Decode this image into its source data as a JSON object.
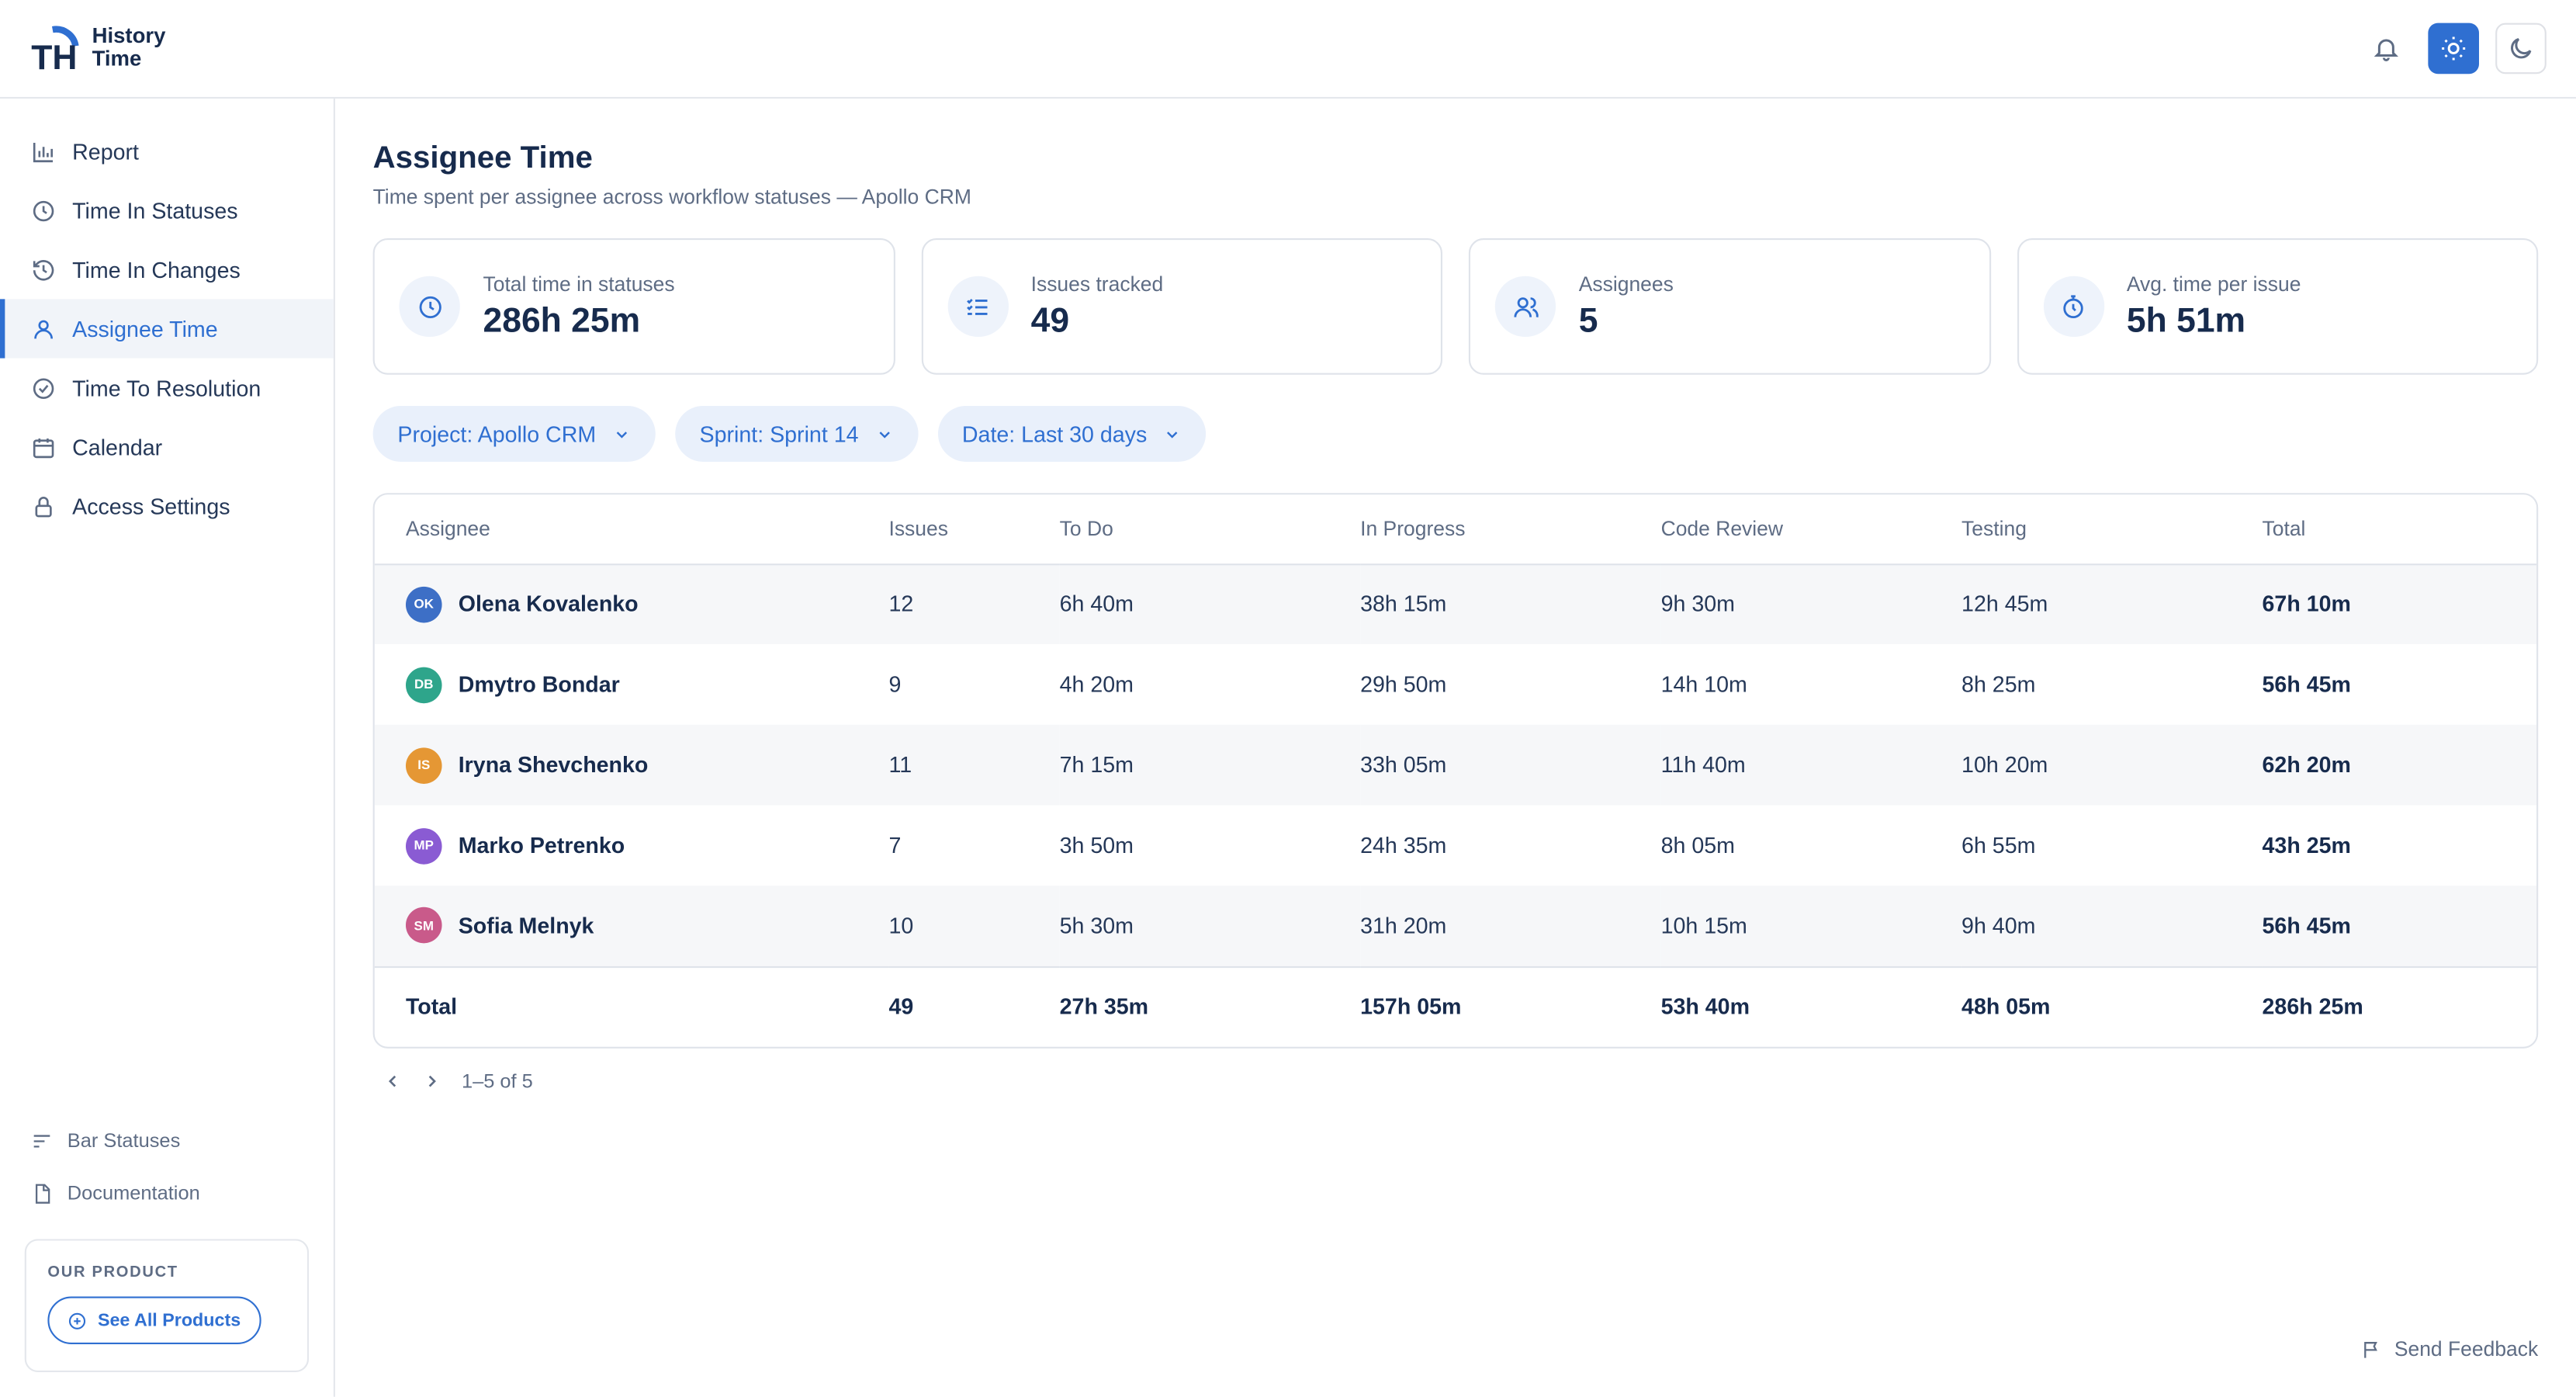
{
  "app": {
    "name_line1": "History",
    "name_line2": "Time",
    "logo_text": "TH"
  },
  "colors": {
    "accent": "#2f6fd1",
    "avatar_ok": "#3d6fc6",
    "avatar_db": "#2ea58b",
    "avatar_is": "#e59734",
    "avatar_mp": "#8a5bd3",
    "avatar_sm": "#c95a8a"
  },
  "header": {
    "icons": [
      "bell-icon",
      "sun-icon",
      "moon-icon"
    ]
  },
  "sidebar": {
    "items": [
      {
        "label": "Report",
        "icon": "bar-chart-icon"
      },
      {
        "label": "Time In Statuses",
        "icon": "clock-icon"
      },
      {
        "label": "Time In Changes",
        "icon": "history-icon"
      },
      {
        "label": "Assignee Time",
        "icon": "user-icon",
        "active": true
      },
      {
        "label": "Time To Resolution",
        "icon": "check-circle-icon"
      },
      {
        "label": "Calendar",
        "icon": "calendar-icon"
      },
      {
        "label": "Access Settings",
        "icon": "lock-icon"
      }
    ],
    "bottom_links": [
      {
        "label": "Bar Statuses",
        "icon": "lines-icon"
      },
      {
        "label": "Documentation",
        "icon": "file-icon"
      }
    ],
    "product": {
      "title": "OUR PRODUCT",
      "button": "See All Products"
    }
  },
  "page": {
    "title": "Assignee Time",
    "subtitle": "Time spent per assignee across workflow statuses — Apollo CRM"
  },
  "stats": [
    {
      "label": "Total time in statuses",
      "value": "286h 25m",
      "icon": "clock-icon"
    },
    {
      "label": "Issues tracked",
      "value": "49",
      "icon": "checklist-icon"
    },
    {
      "label": "Assignees",
      "value": "5",
      "icon": "users-icon"
    },
    {
      "label": "Avg. time per issue",
      "value": "5h 51m",
      "icon": "stopwatch-icon"
    }
  ],
  "filters": [
    {
      "label": "Project: Apollo CRM"
    },
    {
      "label": "Sprint: Sprint 14"
    },
    {
      "label": "Date: Last 30 days"
    }
  ],
  "table": {
    "columns": [
      "Assignee",
      "Issues",
      "To Do",
      "In Progress",
      "Code Review",
      "Testing",
      "Total"
    ],
    "rows": [
      {
        "initials": "OK",
        "name": "Olena Kovalenko",
        "issues": "12",
        "todo": "6h 40m",
        "inprogress": "38h 15m",
        "review": "9h 30m",
        "testing": "12h 45m",
        "total": "67h 10m"
      },
      {
        "initials": "DB",
        "name": "Dmytro Bondar",
        "issues": "9",
        "todo": "4h 20m",
        "inprogress": "29h 50m",
        "review": "14h 10m",
        "testing": "8h 25m",
        "total": "56h 45m"
      },
      {
        "initials": "IS",
        "name": "Iryna Shevchenko",
        "issues": "11",
        "todo": "7h 15m",
        "inprogress": "33h 05m",
        "review": "11h 40m",
        "testing": "10h 20m",
        "total": "62h 20m"
      },
      {
        "initials": "MP",
        "name": "Marko Petrenko",
        "issues": "7",
        "todo": "3h 50m",
        "inprogress": "24h 35m",
        "review": "8h 05m",
        "testing": "6h 55m",
        "total": "43h 25m"
      },
      {
        "initials": "SM",
        "name": "Sofia Melnyk",
        "issues": "10",
        "todo": "5h 30m",
        "inprogress": "31h 20m",
        "review": "10h 15m",
        "testing": "9h 40m",
        "total": "56h 45m"
      }
    ],
    "footer": {
      "label": "Total",
      "issues": "49",
      "todo": "27h 35m",
      "inprogress": "157h 05m",
      "review": "53h 40m",
      "testing": "48h 05m",
      "total": "286h 25m"
    }
  },
  "pager": {
    "text": "1–5 of 5"
  },
  "feedback": {
    "label": "Send Feedback"
  }
}
